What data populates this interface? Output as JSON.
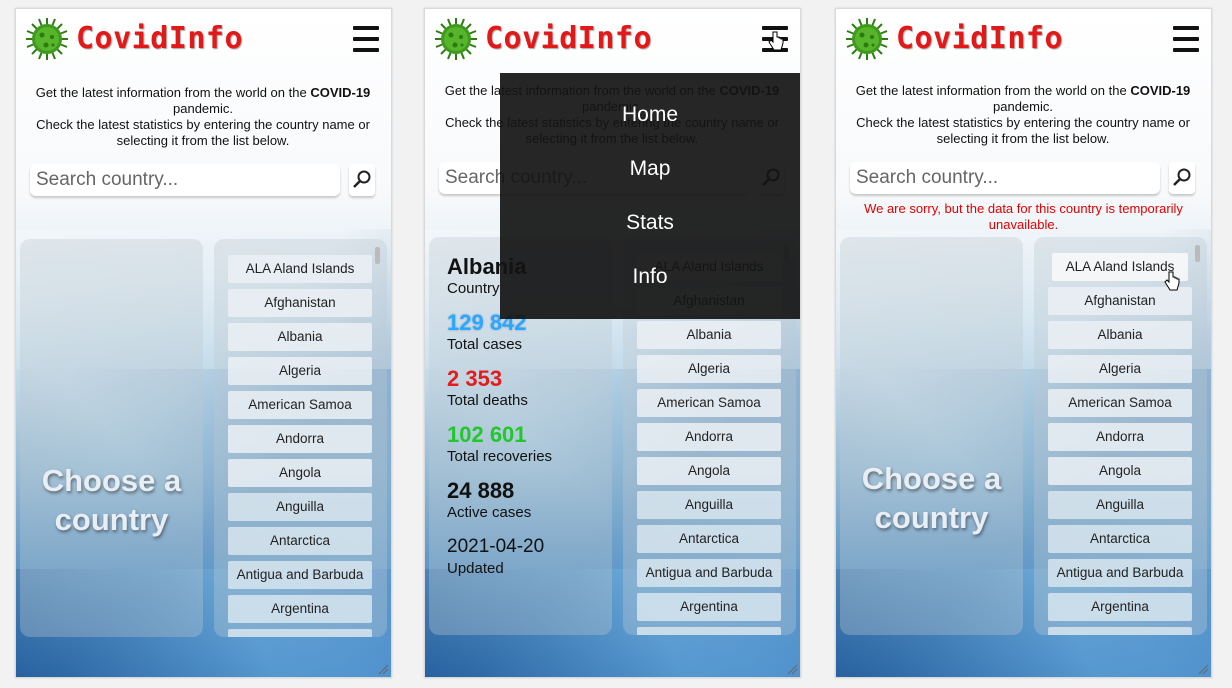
{
  "app": {
    "title": "CovidInfo",
    "intro_prefix": "Get the latest information from the world on the ",
    "intro_bold": "COVID-19",
    "intro_line1_end": " pandemic.",
    "intro_line2": "Check the latest statistics by entering the country name or selecting it from the list below."
  },
  "search": {
    "placeholder": "Search country..."
  },
  "choose_prompt": "Choose a country",
  "error_message": "We are sorry, but the data for this country is temporarily unavailable.",
  "menu": {
    "items": [
      "Home",
      "Map",
      "Stats",
      "Info"
    ]
  },
  "stats": {
    "country_name": "Albania",
    "country_label": "Country",
    "total_cases": "129 842",
    "total_cases_label": "Total cases",
    "total_deaths": "2 353",
    "total_deaths_label": "Total deaths",
    "total_recoveries": "102 601",
    "total_recoveries_label": "Total recoveries",
    "active_cases": "24 888",
    "active_cases_label": "Active cases",
    "updated": "2021-04-20",
    "updated_label": "Updated"
  },
  "countries": [
    "ALA Aland Islands",
    "Afghanistan",
    "Albania",
    "Algeria",
    "American Samoa",
    "Andorra",
    "Angola",
    "Anguilla",
    "Antarctica",
    "Antigua and Barbuda",
    "Argentina",
    ""
  ],
  "colors": {
    "logo_red": "#e31818",
    "cases_blue": "#2ba7ff",
    "deaths_red": "#e31c1c",
    "recoveries_green": "#21c829",
    "error_red": "#e30000"
  }
}
